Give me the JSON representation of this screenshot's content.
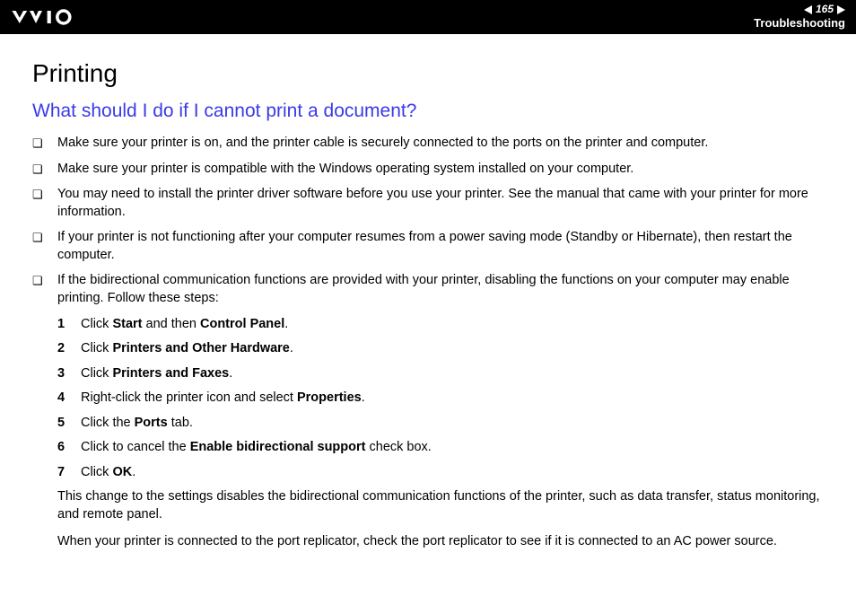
{
  "header": {
    "page_number": "165",
    "section": "Troubleshooting"
  },
  "content": {
    "title": "Printing",
    "subtitle": "What should I do if I cannot print a document?",
    "bullets": [
      "Make sure your printer is on, and the printer cable is securely connected to the ports on the printer and computer.",
      "Make sure your printer is compatible with the Windows operating system installed on your computer.",
      "You may need to install the printer driver software before you use your printer. See the manual that came with your printer for more information.",
      "If your printer is not functioning after your computer resumes from a power saving mode (Standby or Hibernate), then restart the computer.",
      "If the bidirectional communication functions are provided with your printer, disabling the functions on your computer may enable printing. Follow these steps:"
    ],
    "steps": [
      {
        "n": "1",
        "pre": "Click ",
        "b1": "Start",
        "mid": " and then ",
        "b2": "Control Panel",
        "post": "."
      },
      {
        "n": "2",
        "pre": "Click ",
        "b1": "Printers and Other Hardware",
        "mid": "",
        "b2": "",
        "post": "."
      },
      {
        "n": "3",
        "pre": "Click ",
        "b1": "Printers and Faxes",
        "mid": "",
        "b2": "",
        "post": "."
      },
      {
        "n": "4",
        "pre": "Right-click the printer icon and select ",
        "b1": "Properties",
        "mid": "",
        "b2": "",
        "post": "."
      },
      {
        "n": "5",
        "pre": "Click the ",
        "b1": "Ports",
        "mid": "",
        "b2": "",
        "post": " tab."
      },
      {
        "n": "6",
        "pre": "Click to cancel the ",
        "b1": "Enable bidirectional support",
        "mid": "",
        "b2": "",
        "post": " check box."
      },
      {
        "n": "7",
        "pre": "Click ",
        "b1": "OK",
        "mid": "",
        "b2": "",
        "post": "."
      }
    ],
    "closing1": "This change to the settings disables the bidirectional communication functions of the printer, such as data transfer, status monitoring, and remote panel.",
    "closing2": "When your printer is connected to the port replicator, check the port replicator to see if it is connected to an AC power source."
  }
}
